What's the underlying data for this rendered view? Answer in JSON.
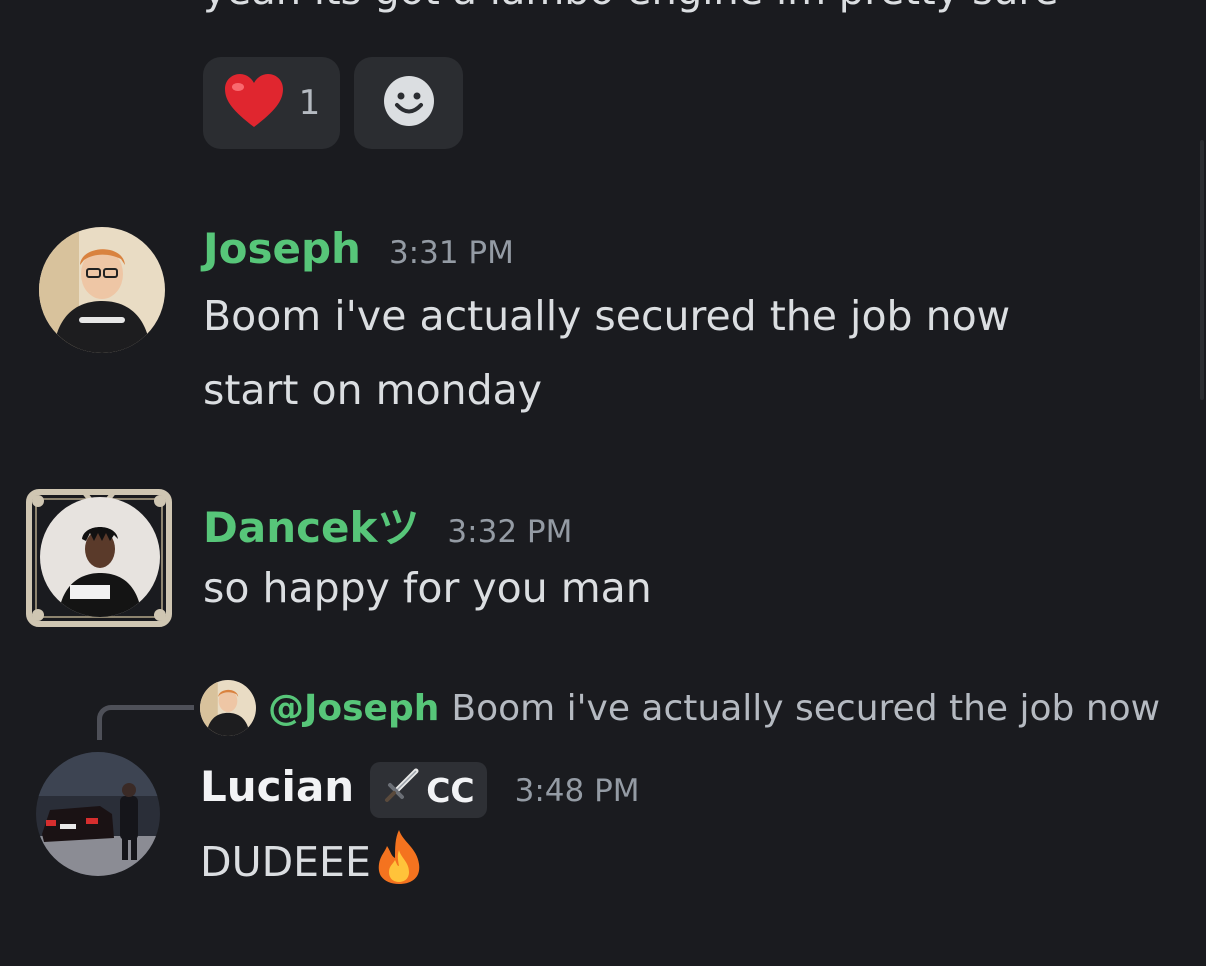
{
  "previous_message": {
    "text": "yeah its got a lambo engine im pretty sure",
    "reactions": [
      {
        "emoji": "❤️",
        "count": "1"
      },
      {
        "icon": "add-reaction-icon"
      }
    ]
  },
  "messages": [
    {
      "username": "Joseph",
      "username_color": "#57c679",
      "time": "3:31 PM",
      "lines": [
        "Boom i've actually secured the job now",
        "start on monday"
      ]
    },
    {
      "username": "Dancekツ",
      "username_color": "#57c679",
      "time": "3:32 PM",
      "lines": [
        "so happy for you man"
      ]
    },
    {
      "reply_to": {
        "mention": "@Joseph",
        "text": "Boom i've actually secured the job now"
      },
      "username": "Lucian",
      "username_color": "#f2f3f5",
      "tag": {
        "icon": "sword-icon",
        "label": "CC"
      },
      "time": "3:48 PM",
      "text": "DUDEEE",
      "emoji": "🔥"
    }
  ],
  "colors": {
    "background": "#1a1b1f",
    "accent_green": "#57c679",
    "muted": "#949ba4"
  }
}
